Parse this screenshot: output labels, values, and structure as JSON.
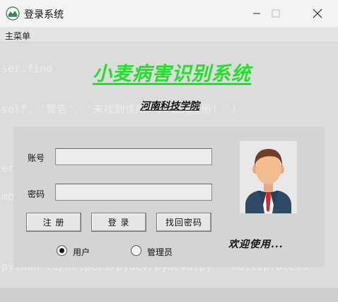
{
  "window": {
    "title": "登录系统"
  },
  "menubar": {
    "items": [
      "主菜单"
    ]
  },
  "header": {
    "title": "小麦病害识别系统",
    "subtitle": "河南科技学院"
  },
  "form": {
    "account_label": "账号",
    "account_value": "",
    "password_label": "密码",
    "password_value": ""
  },
  "buttons": {
    "register": "注 册",
    "login": "登 录",
    "recover": "找回密码"
  },
  "roles": {
    "user": "用户",
    "admin": "管理员",
    "selected": "user"
  },
  "welcome": "欢迎使用...",
  "background_text": [
    "self.phone_number == '':",
    "'警告', '账号或手机号不能为空, 请输入! ')",
    "ser.find",
    "self, '警告', '未找到该用户, 请先注册! ')",
    "er == user_info[0][0] and self.phone_number == u",
    "mber or",
    "python-ce/helpers/pydev/pydevd.py --multiprocess"
  ],
  "colors": {
    "title_green": "#22e02a",
    "accent_text": "#111111"
  }
}
